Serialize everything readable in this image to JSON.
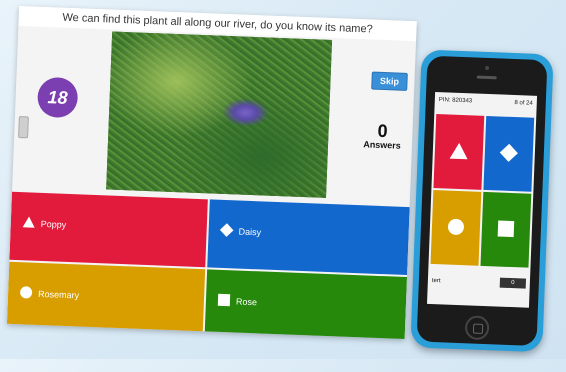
{
  "question": "We can find this plant all along our river, do you know its name?",
  "timer": "18",
  "skip_label": "Skip",
  "answers": {
    "count": "0",
    "label": "Answers"
  },
  "options": [
    {
      "label": "Poppy",
      "shape": "triangle-icon",
      "color": "#e21b3c"
    },
    {
      "label": "Daisy",
      "shape": "diamond-icon",
      "color": "#1368ce"
    },
    {
      "label": "Rosemary",
      "shape": "circle-icon",
      "color": "#d89e00"
    },
    {
      "label": "Rose",
      "shape": "square-icon",
      "color": "#26890c"
    }
  ],
  "phone": {
    "pin": "PIN: 820343",
    "progress": "8 of 24",
    "nickname": "tert",
    "score": "0"
  }
}
